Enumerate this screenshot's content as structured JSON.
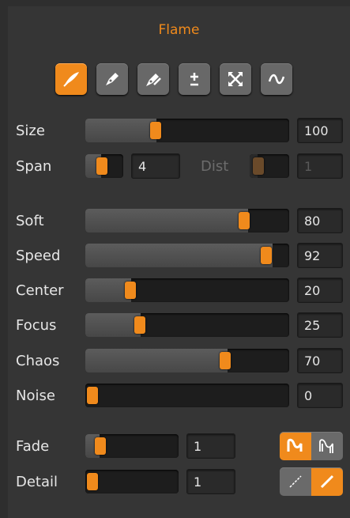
{
  "panel": {
    "title": "Flame"
  },
  "toolbar": {
    "buttons": [
      {
        "icon": "flame-brush-icon",
        "active": true
      },
      {
        "icon": "pen-icon",
        "active": false
      },
      {
        "icon": "pen-clone-icon",
        "active": false
      },
      {
        "icon": "plus-minus-icon",
        "active": false
      },
      {
        "icon": "expand-icon",
        "active": false
      },
      {
        "icon": "wave-icon",
        "active": false
      }
    ]
  },
  "size": {
    "label": "Size",
    "value": "100",
    "level": 0.35
  },
  "span": {
    "label": "Span",
    "value": "4",
    "level": 0.2
  },
  "dist": {
    "label": "Dist",
    "value": "1",
    "level": 0.2,
    "enabled": false
  },
  "sliders": [
    {
      "label": "Soft",
      "value": "80",
      "level": 0.8
    },
    {
      "label": "Speed",
      "value": "92",
      "level": 0.92
    },
    {
      "label": "Center",
      "value": "20",
      "level": 0.2
    },
    {
      "label": "Focus",
      "value": "25",
      "level": 0.25
    },
    {
      "label": "Chaos",
      "value": "70",
      "level": 0.7
    },
    {
      "label": "Noise",
      "value": "0",
      "level": 0.0
    }
  ],
  "fade": {
    "label": "Fade",
    "value": "1",
    "level": 0.1
  },
  "detail": {
    "label": "Detail",
    "value": "1",
    "level": 0.0
  },
  "fade_toggles": [
    {
      "icon": "fade-mode-solid-icon",
      "active": true
    },
    {
      "icon": "fade-mode-outline-icon",
      "active": false
    }
  ],
  "detail_toggles": [
    {
      "icon": "thin-line-icon",
      "active": false
    },
    {
      "icon": "thick-line-icon",
      "active": true
    }
  ],
  "colors": {
    "accent": "#f08a1c",
    "panel": "#353535",
    "track": "#1d1d1d"
  }
}
